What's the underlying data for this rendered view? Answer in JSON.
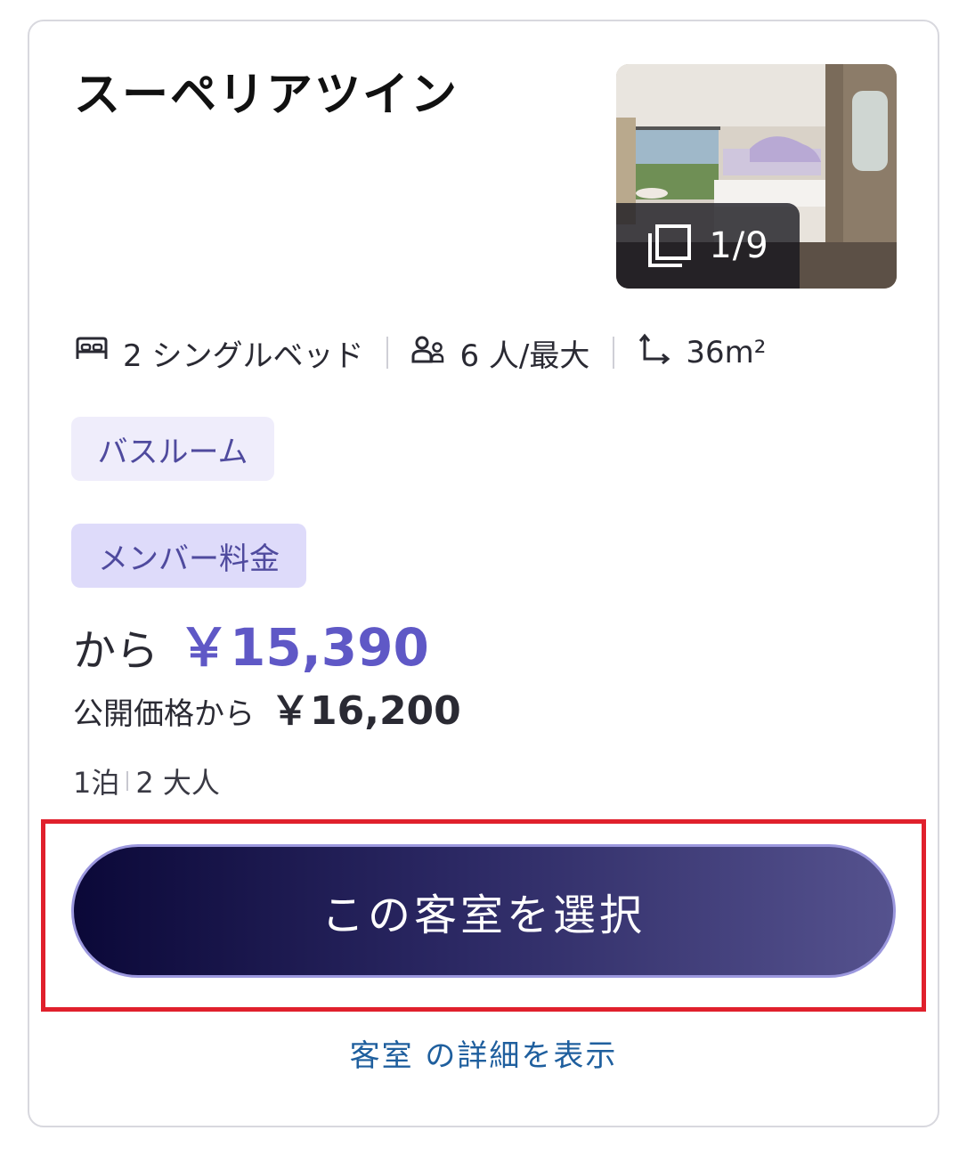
{
  "room": {
    "name": "スーペリアツイン",
    "photo_counter": "1/9"
  },
  "specs": {
    "beds": "2 シングルベッド",
    "occupancy": "6 人/最大",
    "size": "36m²"
  },
  "icons": [
    "bed-icon",
    "people-icon",
    "room-size-icon",
    "gallery-icon"
  ],
  "tags": {
    "bathroom": "バスルーム",
    "member_rate": "メンバー料金"
  },
  "pricing": {
    "from_label": "から",
    "member_price": "￥15,390",
    "public_label": "公開価格から",
    "public_price": "￥16,200",
    "nights": "1泊",
    "guests": "2 大人"
  },
  "actions": {
    "select_label": "この客室を選択",
    "details_label": "客室 の詳細を表示"
  },
  "colors": {
    "price_accent": "#5f58c6",
    "button_gradient_start": "#0b0838",
    "button_gradient_end": "#55528e",
    "highlight_border": "#e0202c",
    "link": "#1f5f9e"
  }
}
